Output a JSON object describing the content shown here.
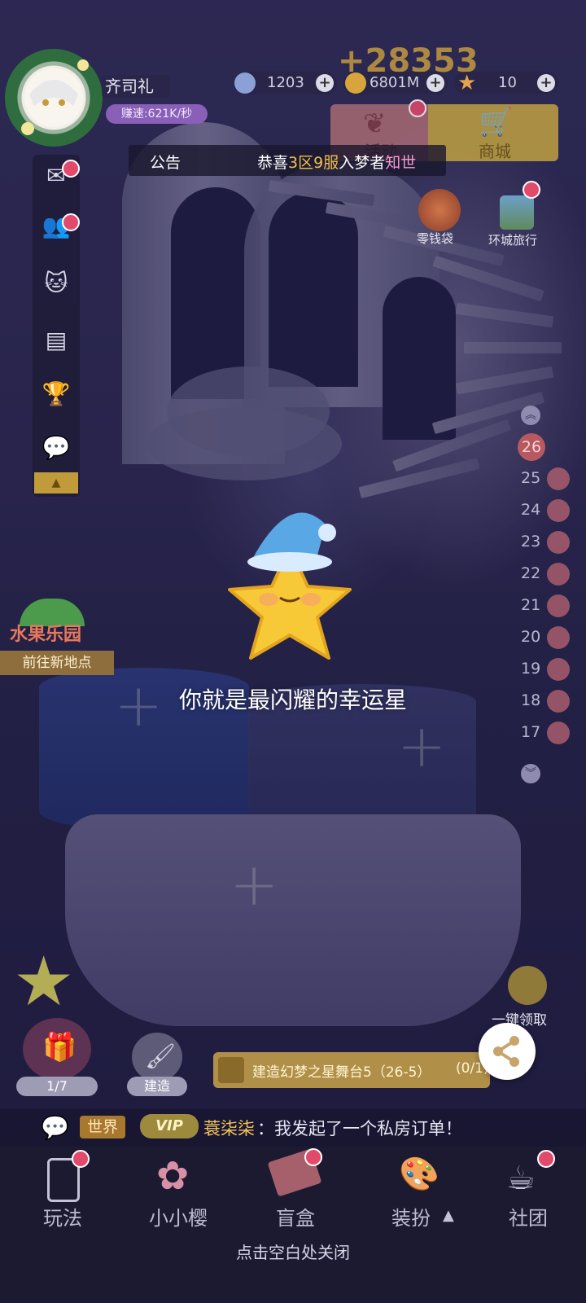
{
  "player": {
    "name": "齐司礼",
    "earn_rate": "赚速:621K/秒"
  },
  "floating_gain": "+28353",
  "resources": [
    {
      "icon": "diamond-icon",
      "value": "1203"
    },
    {
      "icon": "coin-icon",
      "value": "6801M"
    },
    {
      "icon": "star-icon",
      "value": "10"
    }
  ],
  "top_buttons": {
    "activity": "活动",
    "shop": "商城"
  },
  "notice": {
    "label": "公告",
    "prefix": "恭喜",
    "zone": "3区",
    "server": "9服",
    "middle": "入梦者",
    "user": "知世"
  },
  "shortcuts": {
    "pocket_money": "零钱袋",
    "city_travel": "环城旅行"
  },
  "sidebar_icons": [
    "mail-icon",
    "friends-icon",
    "pet-icon",
    "notice-board-icon",
    "trophy-icon",
    "wechat-icon",
    "collapse-arrow-icon"
  ],
  "floors": [
    "26",
    "25",
    "24",
    "23",
    "22",
    "21",
    "20",
    "19",
    "18",
    "17"
  ],
  "fruit_park": {
    "title": "水果乐园",
    "action": "前往新地点"
  },
  "lucky_star_message": "你就是最闪耀的幸运星",
  "gift": {
    "progress": "1/7"
  },
  "build": {
    "label": "建造"
  },
  "collect_all": "一键领取",
  "task": {
    "text": "建造幻梦之星舞台5（26-5）",
    "progress": "(0/1)"
  },
  "chat": {
    "channel": "世界",
    "vip": "VIP",
    "user": "蓑柒柒",
    "message": "：我发起了一个私房订单！"
  },
  "bottom_nav": [
    {
      "label": "玩法",
      "icon": "phone-icon"
    },
    {
      "label": "小小樱",
      "icon": "sakura-icon"
    },
    {
      "label": "盲盒",
      "icon": "ticket-icon"
    },
    {
      "label": "装扮",
      "icon": "dressup-icon"
    },
    {
      "label": "社团",
      "icon": "teacup-icon"
    }
  ],
  "close_hint": "点击空白处关闭",
  "colors": {
    "accent_gold": "#f5c63b",
    "notice_highlight": "#f3c04a",
    "name_pink": "#f59ad0",
    "red_dot": "#e24a6b"
  }
}
